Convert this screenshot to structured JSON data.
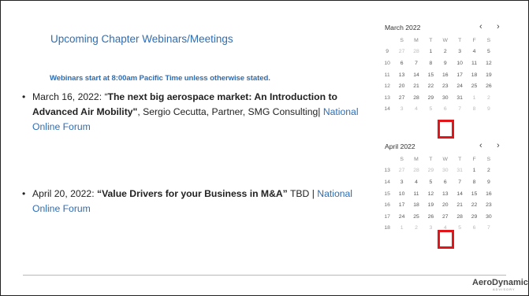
{
  "slide": {
    "title": "Upcoming Chapter Webinars/Meetings",
    "subtitle": "Webinars start at 8:00am Pacific Time unless otherwise stated.",
    "bullets": [
      {
        "date": "March 16, 2022: “",
        "bold": "The next big aerospace market: An Introduction to Advanced Air Mobility\"",
        "rest": ", Sergio Cecutta, Partner, SMG Consulting| ",
        "link": "National Online Forum"
      },
      {
        "date": "April 20, 2022: ",
        "bold": "“Value Drivers for your Business in M&A”",
        "rest": " TBD | ",
        "link": "National Online Forum"
      }
    ],
    "bullet_symbol": "•"
  },
  "calendars": [
    {
      "month": "March 2022",
      "prev": "‹",
      "next": "›",
      "days": [
        "S",
        "M",
        "T",
        "W",
        "T",
        "F",
        "S"
      ],
      "weeks": [
        {
          "wk": "9",
          "d": [
            "27",
            "28",
            "1",
            "2",
            "3",
            "4",
            "5"
          ]
        },
        {
          "wk": "10",
          "d": [
            "6",
            "7",
            "8",
            "9",
            "10",
            "11",
            "12"
          ]
        },
        {
          "wk": "11",
          "d": [
            "13",
            "14",
            "15",
            "16",
            "17",
            "18",
            "19"
          ]
        },
        {
          "wk": "12",
          "d": [
            "20",
            "21",
            "22",
            "23",
            "24",
            "25",
            "26"
          ]
        },
        {
          "wk": "13",
          "d": [
            "27",
            "28",
            "29",
            "30",
            "31",
            "1",
            "2"
          ]
        },
        {
          "wk": "14",
          "d": [
            "3",
            "4",
            "5",
            "6",
            "7",
            "8",
            "9"
          ]
        }
      ],
      "highlight": "16"
    },
    {
      "month": "April 2022",
      "prev": "‹",
      "next": "›",
      "days": [
        "S",
        "M",
        "T",
        "W",
        "T",
        "F",
        "S"
      ],
      "weeks": [
        {
          "wk": "13",
          "d": [
            "27",
            "28",
            "29",
            "30",
            "31",
            "1",
            "2"
          ]
        },
        {
          "wk": "14",
          "d": [
            "3",
            "4",
            "5",
            "6",
            "7",
            "8",
            "9"
          ]
        },
        {
          "wk": "15",
          "d": [
            "10",
            "11",
            "12",
            "13",
            "14",
            "15",
            "16"
          ]
        },
        {
          "wk": "16",
          "d": [
            "17",
            "18",
            "19",
            "20",
            "21",
            "22",
            "23"
          ]
        },
        {
          "wk": "17",
          "d": [
            "24",
            "25",
            "26",
            "27",
            "28",
            "29",
            "30"
          ]
        },
        {
          "wk": "18",
          "d": [
            "1",
            "2",
            "3",
            "4",
            "5",
            "6",
            "7"
          ]
        }
      ],
      "highlight": "20"
    }
  ],
  "logo": {
    "text": "AeroDynamic",
    "sub": "ADVISORY"
  },
  "colors": {
    "accent": "#2e6db4",
    "highlight": "#e0161a"
  }
}
